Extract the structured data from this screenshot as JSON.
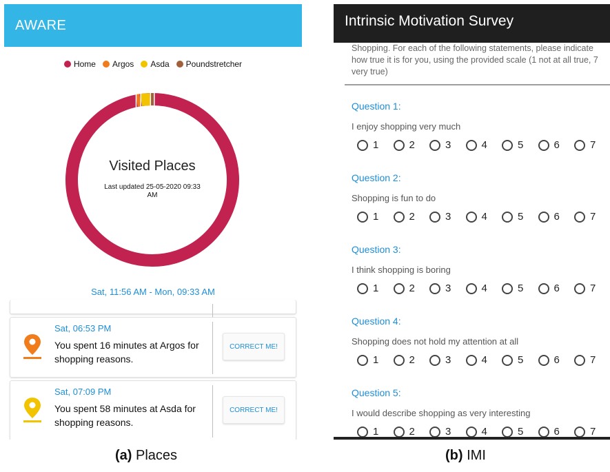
{
  "left": {
    "app_title": "AWARE",
    "legend": [
      {
        "label": "Home",
        "color": "#c2224f"
      },
      {
        "label": "Argos",
        "color": "#f07c1c"
      },
      {
        "label": "Asda",
        "color": "#f2c300"
      },
      {
        "label": "Poundstretcher",
        "color": "#a0603a"
      }
    ],
    "donut": {
      "title": "Visited Places",
      "updated": "Last updated 25-05-2020 09:33 AM"
    },
    "range": "Sat, 11:56 AM - Mon, 09:33 AM",
    "cards": [
      {
        "time": "Sat, 06:53 PM",
        "message": "You spent 16 minutes at Argos for shopping reasons.",
        "button": "CORRECT ME!",
        "pin_color": "#f07c1c",
        "icon": "location-pin-orange"
      },
      {
        "time": "Sat, 07:09 PM",
        "message": "You spent 58 minutes at Asda for shopping reasons.",
        "button": "CORRECT ME!",
        "pin_color": "#f2c300",
        "icon": "location-pin-yellow"
      }
    ]
  },
  "right": {
    "title": "Intrinsic Motivation Survey",
    "intro": "Shopping. For each of the following statements, please indicate how true it is for you, using the provided scale (1 not at all true, 7 very true)",
    "scale": [
      "1",
      "2",
      "3",
      "4",
      "5",
      "6",
      "7"
    ],
    "questions": [
      {
        "title": "Question 1:",
        "text": "I enjoy shopping very much"
      },
      {
        "title": "Question 2:",
        "text": "Shopping is fun to do"
      },
      {
        "title": "Question 3:",
        "text": "I think shopping is boring"
      },
      {
        "title": "Question 4:",
        "text": "Shopping does not hold my attention at all"
      },
      {
        "title": "Question 5:",
        "text": "I would describe shopping as very interesting"
      }
    ]
  },
  "captions": {
    "a_tag": "(a)",
    "a_label": "Places",
    "b_tag": "(b)",
    "b_label": "IMI"
  }
}
